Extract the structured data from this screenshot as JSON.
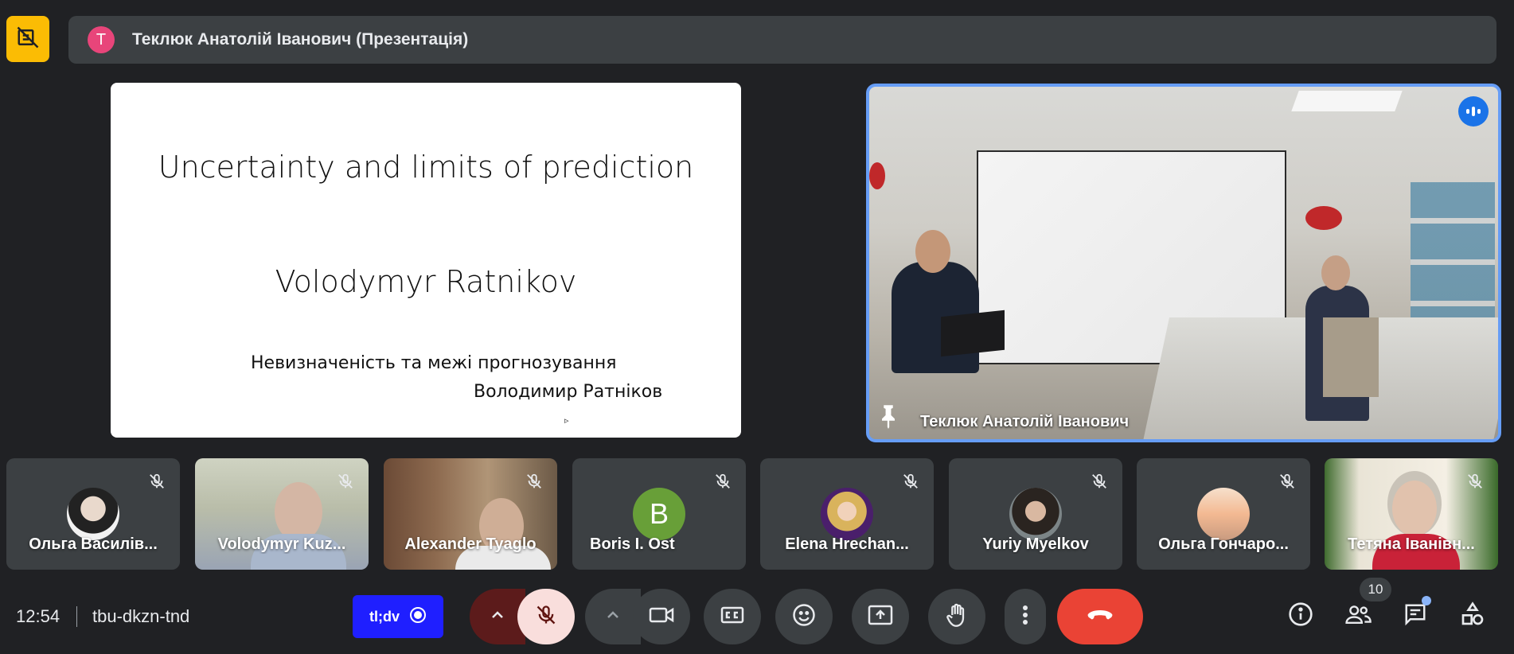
{
  "header": {
    "presenter_initial": "Т",
    "presenter_title": "Теклюк Анатолій Іванович (Презентація)",
    "presenter_avatar_color": "#e8457a",
    "present_button_color": "#fbbc04"
  },
  "slide": {
    "title": "Uncertainty and limits of prediction",
    "author": "Volodymyr Ratnikov",
    "subtitle_ua": "Невизначеність та межі прогнозування",
    "author_ua": "Володимир Ратніков",
    "cursor_glyph": "▹"
  },
  "camera": {
    "name": "Теклюк Анатолій Іванович",
    "border_color": "#669df6"
  },
  "participants": [
    {
      "name": "Ольга Василів..."
    },
    {
      "name": "Volodymyr Kuz..."
    },
    {
      "name": "Alexander Tyaglo"
    },
    {
      "name": "Boris I. Ost",
      "initial": "B",
      "avatar_color": "#689f38"
    },
    {
      "name": "Elena Hrechan..."
    },
    {
      "name": "Yuriy Myelkov"
    },
    {
      "name": "Ольга Гончаро..."
    },
    {
      "name": "Тетяна Іванівн..."
    }
  ],
  "footer": {
    "time": "12:54",
    "meeting_code": "tbu-dkzn-tnd",
    "tldv_label": "tl;dv",
    "participant_count": "10",
    "end_call_color": "#ea4335"
  },
  "icons": {
    "present": "presentation-off-icon",
    "mic": "mic-off-icon",
    "camera": "videocam-icon",
    "cc": "closed-caption-icon",
    "emoji": "emoji-icon",
    "present_now": "present-to-all-icon",
    "hand": "raise-hand-icon",
    "more": "more-vert-icon",
    "end": "call-end-icon",
    "info": "info-icon",
    "people": "people-icon",
    "chat": "chat-icon",
    "activities": "activities-icon"
  }
}
